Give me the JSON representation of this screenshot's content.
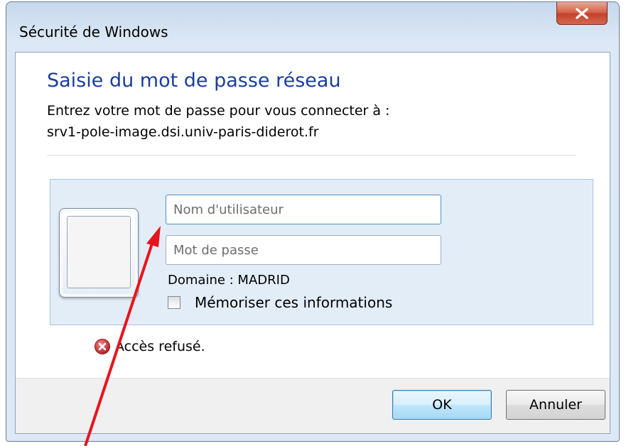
{
  "window": {
    "title": "Sécurité de Windows"
  },
  "dialog": {
    "heading": "Saisie du mot de passe réseau",
    "description_line1": "Entrez votre mot de passe pour vous connecter à :",
    "description_line2": "srv1-pole-image.dsi.univ-paris-diderot.fr"
  },
  "credentials": {
    "username_placeholder": "Nom d'utilisateur",
    "password_placeholder": "Mot de passe",
    "domain_label": "Domaine : MADRID",
    "remember_label": "Mémoriser ces informations",
    "remember_checked": false
  },
  "error": {
    "message": "Accès refusé."
  },
  "buttons": {
    "ok_label": "OK",
    "cancel_label": "Annuler"
  },
  "colors": {
    "heading": "#1a3e9e",
    "annotation_arrow": "#e8141b",
    "error_icon": "#c62d2d"
  },
  "icons": {
    "close": "close-x-icon",
    "error": "error-circle-icon",
    "user": "user-tile-icon"
  }
}
